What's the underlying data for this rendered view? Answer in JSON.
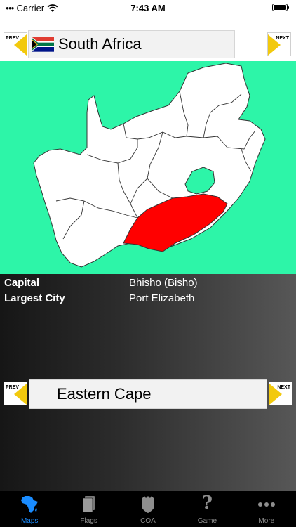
{
  "status_bar": {
    "carrier": "Carrier",
    "time": "7:43 AM"
  },
  "country": {
    "prev_label": "PREV",
    "next_label": "NEXT",
    "name": "South Africa",
    "flag_icon": "south-africa-flag-icon"
  },
  "map": {
    "background_color": "#2df5a8",
    "selected_color": "#ff0000",
    "highlighted_region": "Eastern Cape"
  },
  "info": {
    "capital_label": "Capital",
    "capital_value": "Bhisho (Bisho)",
    "largest_city_label": "Largest City",
    "largest_city_value": "Port Elizabeth"
  },
  "region": {
    "prev_label": "PREV",
    "next_label": "NEXT",
    "name": "Eastern Cape"
  },
  "tabs": [
    {
      "label": "Maps",
      "icon": "africa-icon",
      "active": true
    },
    {
      "label": "Flags",
      "icon": "flags-icon",
      "active": false
    },
    {
      "label": "COA",
      "icon": "shield-icon",
      "active": false
    },
    {
      "label": "Game",
      "icon": "question-icon",
      "active": false
    },
    {
      "label": "More",
      "icon": "more-icon",
      "active": false
    }
  ],
  "colors": {
    "accent": "#1a8cff",
    "nav_arrow": "#f2c90d"
  }
}
